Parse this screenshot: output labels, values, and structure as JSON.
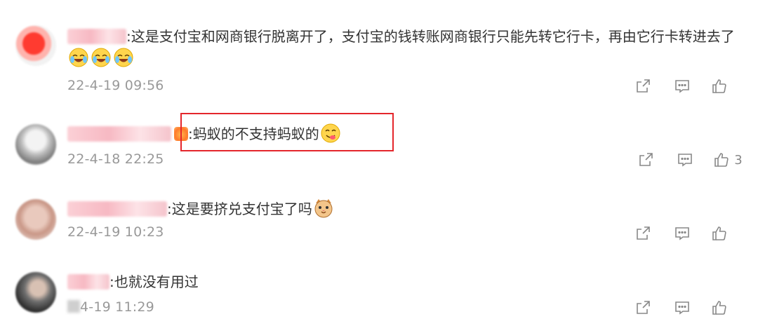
{
  "comments": [
    {
      "text_suffix": ":这是支付宝和网商银行脱离开了，支付宝的钱转账网商银行只能先转它行卡，再由它行卡转进去了",
      "emoji_count_note": "3 laughing-crying emojis",
      "timestamp": "22-4-19 09:56",
      "likes": ""
    },
    {
      "text_suffix": ":蚂蚁的不支持蚂蚁的",
      "emoji_note": "yummy emoji",
      "timestamp": "22-4-18 22:25",
      "likes": "3",
      "highlighted": true
    },
    {
      "text_suffix": ":这是要挤兑支付宝了吗",
      "emoji_note": "cat emoji",
      "timestamp": "22-4-19 10:23",
      "likes": ""
    },
    {
      "text_suffix": ":也就没有用过",
      "timestamp": "4-19 11:29",
      "likes": ""
    }
  ],
  "icons": [
    "share-icon",
    "comment-icon",
    "like-icon"
  ],
  "colors": {
    "highlight": "#e4262b",
    "meta": "#999999",
    "action": "#888888"
  }
}
